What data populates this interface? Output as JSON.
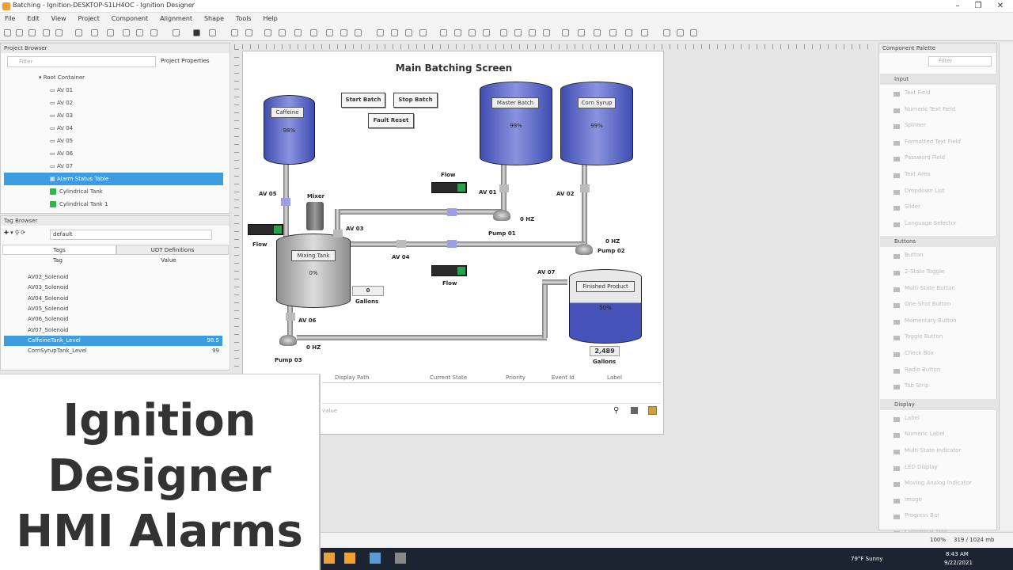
{
  "window": {
    "title": "Batching - Ignition-DESKTOP-S1LH4OC - Ignition Designer"
  },
  "menu": [
    "File",
    "Edit",
    "View",
    "Project",
    "Component",
    "Alignment",
    "Shape",
    "Tools",
    "Help"
  ],
  "project_browser": {
    "title": "Project Browser",
    "filter_placeholder": "Filter",
    "properties_tab": "Project Properties",
    "root": "Root Container",
    "items": [
      "AV 01",
      "AV 02",
      "AV 03",
      "AV 04",
      "AV 05",
      "AV 06",
      "AV 07"
    ],
    "selected": "Alarm Status Table",
    "components": [
      "Cylindrical Tank",
      "Cylindrical Tank 1"
    ]
  },
  "tag_browser": {
    "title": "Tag Browser",
    "provider": "default",
    "tabs": [
      "Tags",
      "UDT Definitions"
    ],
    "columns": [
      "Tag",
      "Value"
    ],
    "rows": [
      {
        "name": "AV02_Solenoid",
        "value": ""
      },
      {
        "name": "AV03_Solenoid",
        "value": ""
      },
      {
        "name": "AV04_Solenoid",
        "value": ""
      },
      {
        "name": "AV05_Solenoid",
        "value": ""
      },
      {
        "name": "AV06_Solenoid",
        "value": ""
      },
      {
        "name": "AV07_Solenoid",
        "value": ""
      },
      {
        "name": "CaffeineTank_Level",
        "value": "98.5",
        "selected": true
      },
      {
        "name": "CornSyrupTank_Level",
        "value": "99"
      }
    ]
  },
  "screen": {
    "title": "Main Batching Screen",
    "buttons": {
      "start": "Start Batch",
      "stop": "Stop Batch",
      "fault": "Fault Reset"
    },
    "tanks": {
      "caffeine": {
        "label": "Caffeine",
        "pct": "98%"
      },
      "master": {
        "label": "Master Batch",
        "pct": "99%"
      },
      "corn": {
        "label": "Corn Syrup",
        "pct": "99%"
      },
      "mixing": {
        "label": "Mixing Tank",
        "pct": "0%"
      },
      "finished": {
        "label": "Finished Product",
        "pct": "50%"
      }
    },
    "labels": {
      "av05": "AV 05",
      "av01": "AV 01",
      "av02": "AV 02",
      "av03": "AV 03",
      "av04": "AV 04",
      "av06": "AV 06",
      "av07": "AV 07",
      "mixer": "Mixer",
      "flow": "Flow",
      "pump01": "Pump 01",
      "pump02": "Pump 02",
      "pump03": "Pump 03",
      "hz": "0 HZ",
      "gallons": "Gallons",
      "mix_gallons": "0",
      "fin_gallons": "2,489"
    },
    "alarm_table": {
      "columns": [
        "Display Path",
        "Current State",
        "Priority",
        "Event Id",
        "Label"
      ],
      "search_placeholder": "value"
    }
  },
  "palette": {
    "title": "Component Palette",
    "filter_placeholder": "Filter",
    "sections": [
      {
        "name": "Input",
        "items": [
          "Text Field",
          "Numeric Text Field",
          "Spinner",
          "Formatted Text Field",
          "Password Field",
          "Text Area",
          "Dropdown List",
          "Slider",
          "Language Selector"
        ]
      },
      {
        "name": "Buttons",
        "items": [
          "Button",
          "2-State Toggle",
          "Multi-State Button",
          "One-Shot Button",
          "Momentary Button",
          "Toggle Button",
          "Check Box",
          "Radio Button",
          "Tab Strip"
        ]
      },
      {
        "name": "Display",
        "items": [
          "Label",
          "Numeric Label",
          "Multi-State Indicator",
          "LED Display",
          "Moving Analog Indicator",
          "Image",
          "Progress Bar",
          "Cylindrical Tank"
        ]
      }
    ]
  },
  "status": {
    "zoom": "100%",
    "memory": "319 / 1024 mb",
    "weather": "79°F Sunny",
    "time": "8:43 AM",
    "date": "9/22/2021"
  },
  "overlay": {
    "line1": "Ignition",
    "line2": "Designer",
    "line3": "HMI Alarms"
  }
}
